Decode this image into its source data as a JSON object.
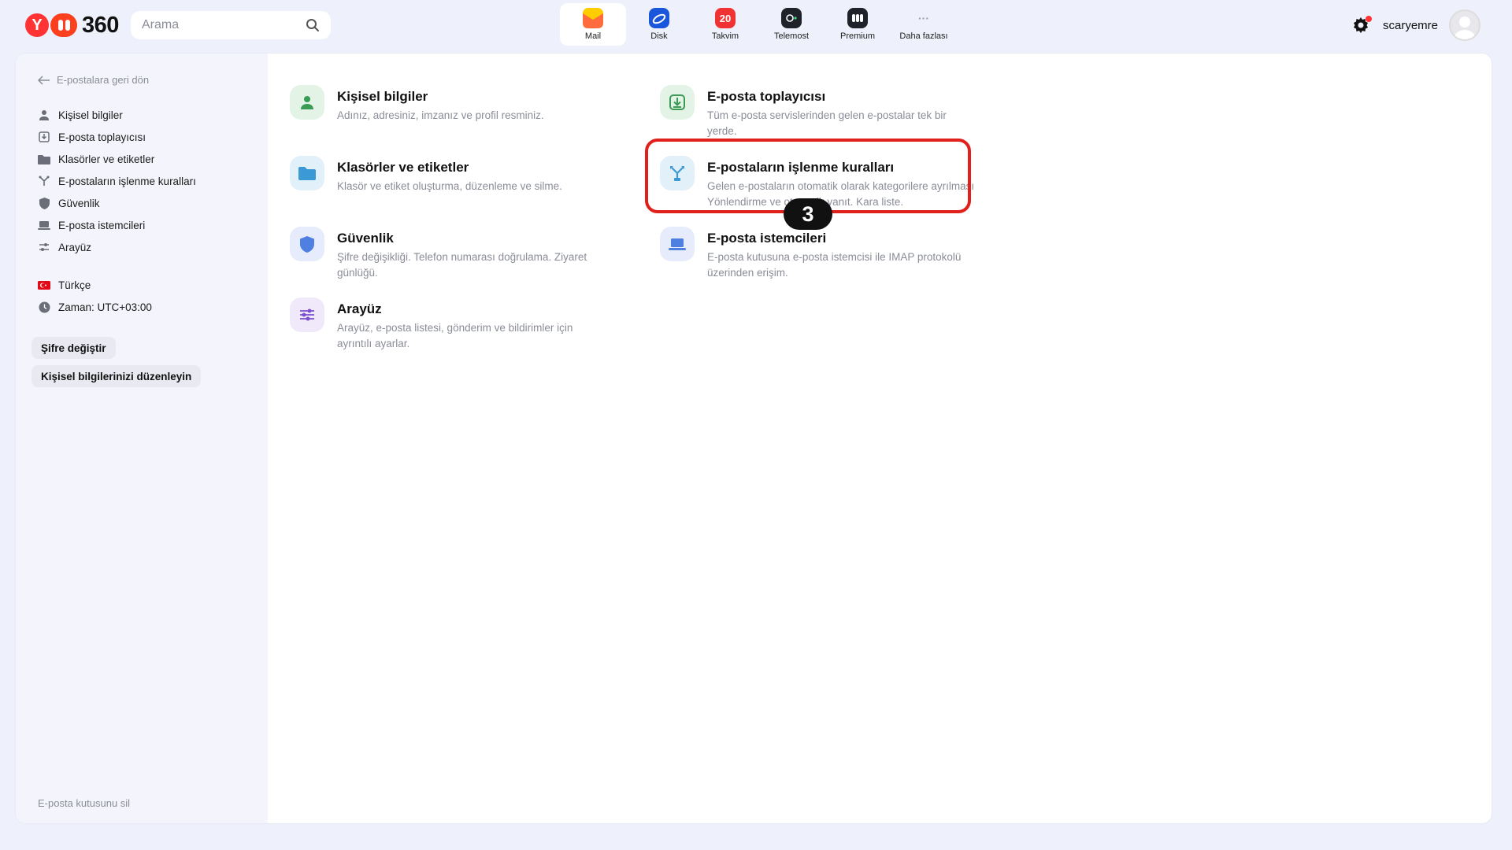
{
  "logo": {
    "y": "Y",
    "text": "360"
  },
  "search": {
    "placeholder": "Arama"
  },
  "apps": [
    {
      "label": "Mail",
      "icon": "mail-icon",
      "active": true,
      "color": "#ffcc00"
    },
    {
      "label": "Disk",
      "icon": "disk-icon",
      "color": "#1a56db"
    },
    {
      "label": "Takvim",
      "icon": "calendar-icon",
      "badge": "20",
      "color": "#f03232"
    },
    {
      "label": "Telemost",
      "icon": "telemost-icon",
      "color": "#1f2228"
    },
    {
      "label": "Premium",
      "icon": "premium-icon",
      "color": "#1f2228"
    },
    {
      "label": "Daha fazlası",
      "icon": "more-icon",
      "color": "#9aa0ad"
    }
  ],
  "user": {
    "name": "scaryemre"
  },
  "sidebar": {
    "back": "E-postalara geri dön",
    "items": [
      {
        "label": "Kişisel bilgiler",
        "icon": "person-icon"
      },
      {
        "label": "E-posta toplayıcısı",
        "icon": "collector-icon"
      },
      {
        "label": "Klasörler ve etiketler",
        "icon": "folder-icon"
      },
      {
        "label": "E-postaların işlenme kuralları",
        "icon": "rules-icon"
      },
      {
        "label": "Güvenlik",
        "icon": "shield-icon"
      },
      {
        "label": "E-posta istemcileri",
        "icon": "laptop-icon"
      },
      {
        "label": "Arayüz",
        "icon": "sliders-icon"
      }
    ],
    "language": "Türkçe",
    "timezone": "Zaman: UTC+03:00",
    "buttons": {
      "change_password": "Şifre değiştir",
      "edit_personal": "Kişisel bilgilerinizi düzenleyin"
    },
    "delete_mailbox": "E-posta kutusunu sil"
  },
  "tiles": {
    "personal": {
      "title": "Kişisel bilgiler",
      "desc": "Adınız, adresiniz, imzanız ve profil resminiz."
    },
    "collector": {
      "title": "E-posta toplayıcısı",
      "desc": "Tüm e-posta servislerinden gelen e-postalar tek bir yerde."
    },
    "folders": {
      "title": "Klasörler ve etiketler",
      "desc": "Klasör ve etiket oluşturma, düzenleme ve silme."
    },
    "rules": {
      "title": "E-postaların işlenme kuralları",
      "desc": "Gelen e-postaların otomatik olarak kategorilere ayrılması Yönlendirme ve otomatik yanıt. Kara liste."
    },
    "security": {
      "title": "Güvenlik",
      "desc": "Şifre değişikliği. Telefon numarası doğrulama. Ziyaret günlüğü."
    },
    "clients": {
      "title": "E-posta istemcileri",
      "desc": "E-posta kutusuna e-posta istemcisi ile IMAP protokolü üzerinden erişim."
    },
    "interface": {
      "title": "Arayüz",
      "desc": "Arayüz, e-posta listesi, gönderim ve bildirimler için ayrıntılı ayarlar."
    }
  },
  "annotation": {
    "step": "3",
    "color": "#e0201b"
  }
}
